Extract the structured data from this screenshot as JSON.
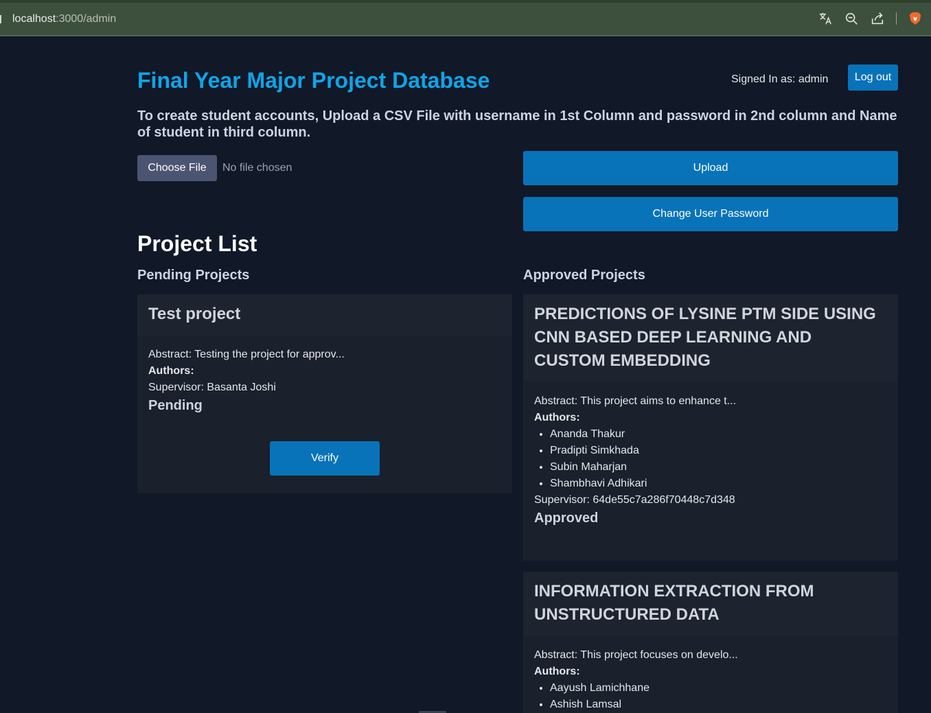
{
  "browser": {
    "url_host": "localhost",
    "url_path": ":3000/admin"
  },
  "header": {
    "title": "Final Year Major Project Database",
    "signed_in": "Signed In as: admin",
    "logout_label": "Log out"
  },
  "upload": {
    "instructions": "To create student accounts, Upload a CSV File with username in 1st Column and password in 2nd column and Name of student in third column.",
    "choose_file_label": "Choose File",
    "no_file_text": "No file chosen",
    "upload_label": "Upload",
    "change_password_label": "Change User Password"
  },
  "projects": {
    "heading": "Project List",
    "pending_heading": "Pending Projects",
    "approved_heading": "Approved Projects",
    "pending": [
      {
        "title": "Test project",
        "abstract": "Abstract: Testing the project for approv...",
        "authors_label": "Authors:",
        "supervisor": "Supervisor: Basanta Joshi",
        "status": "Pending",
        "verify_label": "Verify"
      }
    ],
    "approved": [
      {
        "title": "PREDICTIONS OF LYSINE PTM SIDE USING CNN BASED DEEP LEARNING AND CUSTOM EMBEDDING",
        "abstract": "Abstract: This project aims to enhance t...",
        "authors_label": "Authors:",
        "authors": [
          "Ananda Thakur",
          "Pradipti Simkhada",
          "Subin Maharjan",
          "Shambhavi Adhikari"
        ],
        "supervisor": "Supervisor: 64de55c7a286f70448c7d348",
        "status": "Approved"
      },
      {
        "title": "INFORMATION EXTRACTION FROM UNSTRUCTURED DATA",
        "abstract": "Abstract: This project focuses on develo...",
        "authors_label": "Authors:",
        "authors": [
          "Aayush Lamichhane",
          "Ashish Lamsal"
        ]
      }
    ]
  },
  "icons": [
    "translate-icon",
    "zoom-out-icon",
    "share-icon",
    "brave-lion-icon"
  ],
  "colors": {
    "background": "#111827",
    "card": "#1a202c",
    "accent": "#0873b9",
    "title": "#0ea5e9"
  }
}
